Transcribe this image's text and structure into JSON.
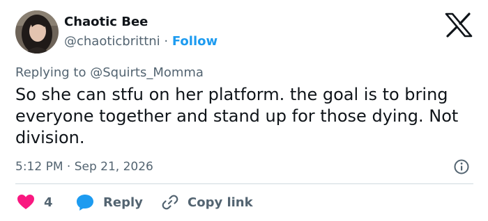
{
  "author": {
    "display_name": "Chaotic Bee",
    "handle": "@chaoticbrittni",
    "separator": "·",
    "follow_label": "Follow"
  },
  "reply_context": {
    "prefix": "Replying to",
    "mention": "@Squirts_Momma"
  },
  "tweet": {
    "text": "So she can stfu on her platform. the goal is to bring everyone together and stand up for those dying. Not division."
  },
  "meta": {
    "time": "5:12 PM",
    "separator": "·",
    "date": "Sep 21, 2026"
  },
  "actions": {
    "like_count": "4",
    "reply_label": "Reply",
    "copy_link_label": "Copy link"
  },
  "colors": {
    "like": "#f91880",
    "reply": "#1d9bf0",
    "follow": "#1d9bf0",
    "muted": "#536471"
  },
  "icons": [
    "x-logo-icon",
    "info-icon",
    "heart-icon",
    "reply-bubble-icon",
    "link-icon"
  ]
}
